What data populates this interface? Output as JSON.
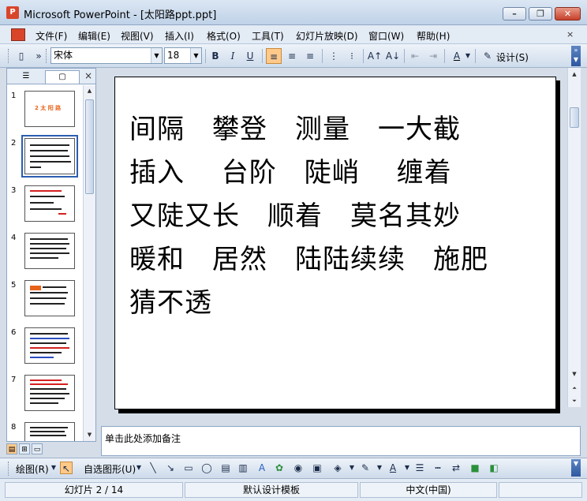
{
  "window": {
    "title": "Microsoft PowerPoint - [太阳路ppt.ppt]",
    "app_icon": "P",
    "minimize_glyph": "–",
    "restore_glyph": "❐",
    "close_glyph": "✕"
  },
  "menubar": {
    "items": [
      "文件(F)",
      "编辑(E)",
      "视图(V)",
      "插入(I)",
      "格式(O)",
      "工具(T)",
      "幻灯片放映(D)",
      "窗口(W)",
      "帮助(H)"
    ],
    "doc_close": "×"
  },
  "toolbar": {
    "font_name": "宋体",
    "font_size": "18",
    "bold": "B",
    "italic": "I",
    "underline": "U",
    "design_label": "设计(S)",
    "accent": "#ffc98a"
  },
  "left_panel": {
    "tab_outline": "☰",
    "tab_slides": "▢",
    "close": "×",
    "slide_numbers": [
      "1",
      "2",
      "3",
      "4",
      "5",
      "6",
      "7",
      "8"
    ],
    "thumb1_text": "2 太 阳 路"
  },
  "slide": {
    "lines": [
      "间隔　攀登　测量　一大截",
      "插入　 台阶　陡峭　 缠着",
      "又陡又长　顺着　莫名其妙",
      "暖和　居然　陆陆续续　施肥",
      "猜不透"
    ]
  },
  "notes": {
    "placeholder": "单击此处添加备注"
  },
  "drawbar": {
    "draw_label": "绘图(R)",
    "autoshape_label": "自选图形(U)"
  },
  "status": {
    "slide_position": "幻灯片 2 / 14",
    "design_template": "默认设计模板",
    "language": "中文(中国)"
  }
}
